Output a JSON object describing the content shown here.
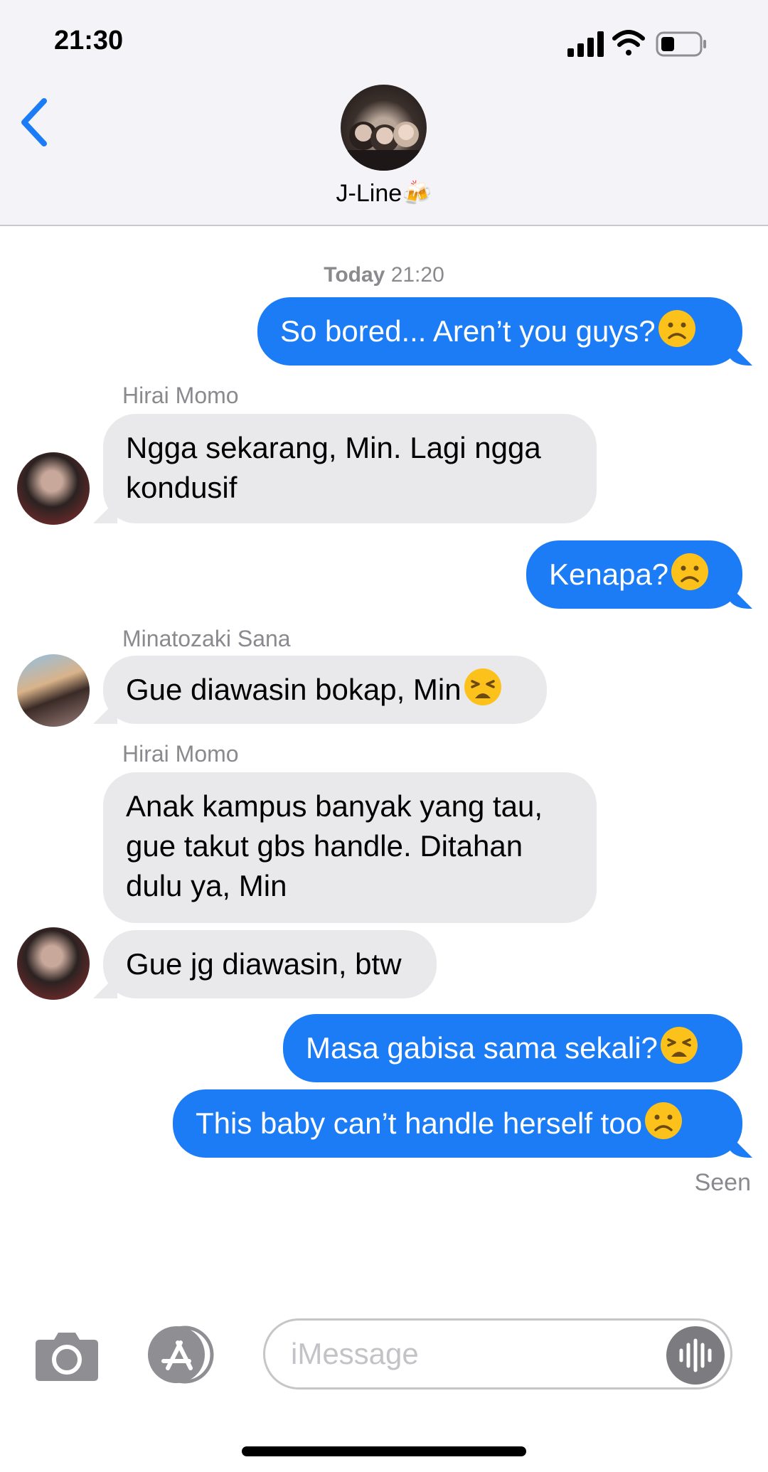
{
  "status": {
    "time": "21:30"
  },
  "header": {
    "title": "J-Line🍻"
  },
  "chat": {
    "timestamp_day": "Today",
    "timestamp_time": "21:20",
    "messages": [
      {
        "dir": "out",
        "text": "So bored... Aren’t you guys?",
        "emoji": "frown"
      },
      {
        "dir": "in",
        "sender": "Hirai Momo",
        "text": "Ngga sekarang, Min. Lagi ngga kondusif"
      },
      {
        "dir": "out",
        "text": "Kenapa?",
        "emoji": "frown"
      },
      {
        "dir": "in",
        "sender": "Minatozaki Sana",
        "text": "Gue diawasin bokap, Min",
        "emoji": "tired"
      },
      {
        "dir": "in",
        "sender": "Hirai Momo",
        "text": "Anak kampus banyak yang tau, gue takut gbs handle. Ditahan dulu ya, Min"
      },
      {
        "dir": "in",
        "text": "Gue jg diawasin, btw"
      },
      {
        "dir": "out",
        "text": "Masa gabisa sama sekali?",
        "emoji": "tired"
      },
      {
        "dir": "out",
        "text": "This baby can’t handle herself too",
        "emoji": "frown"
      }
    ],
    "seen": "Seen"
  },
  "input": {
    "placeholder": "iMessage"
  },
  "icons": [
    "signal-icon",
    "wifi-icon",
    "battery-icon",
    "back-chevron-icon",
    "camera-icon",
    "app-store-icon",
    "audio-waveform-icon"
  ],
  "colors": {
    "outgoing": "#1b7cf5",
    "incoming": "#e9e9eb",
    "accent": "#1b7cf5"
  }
}
